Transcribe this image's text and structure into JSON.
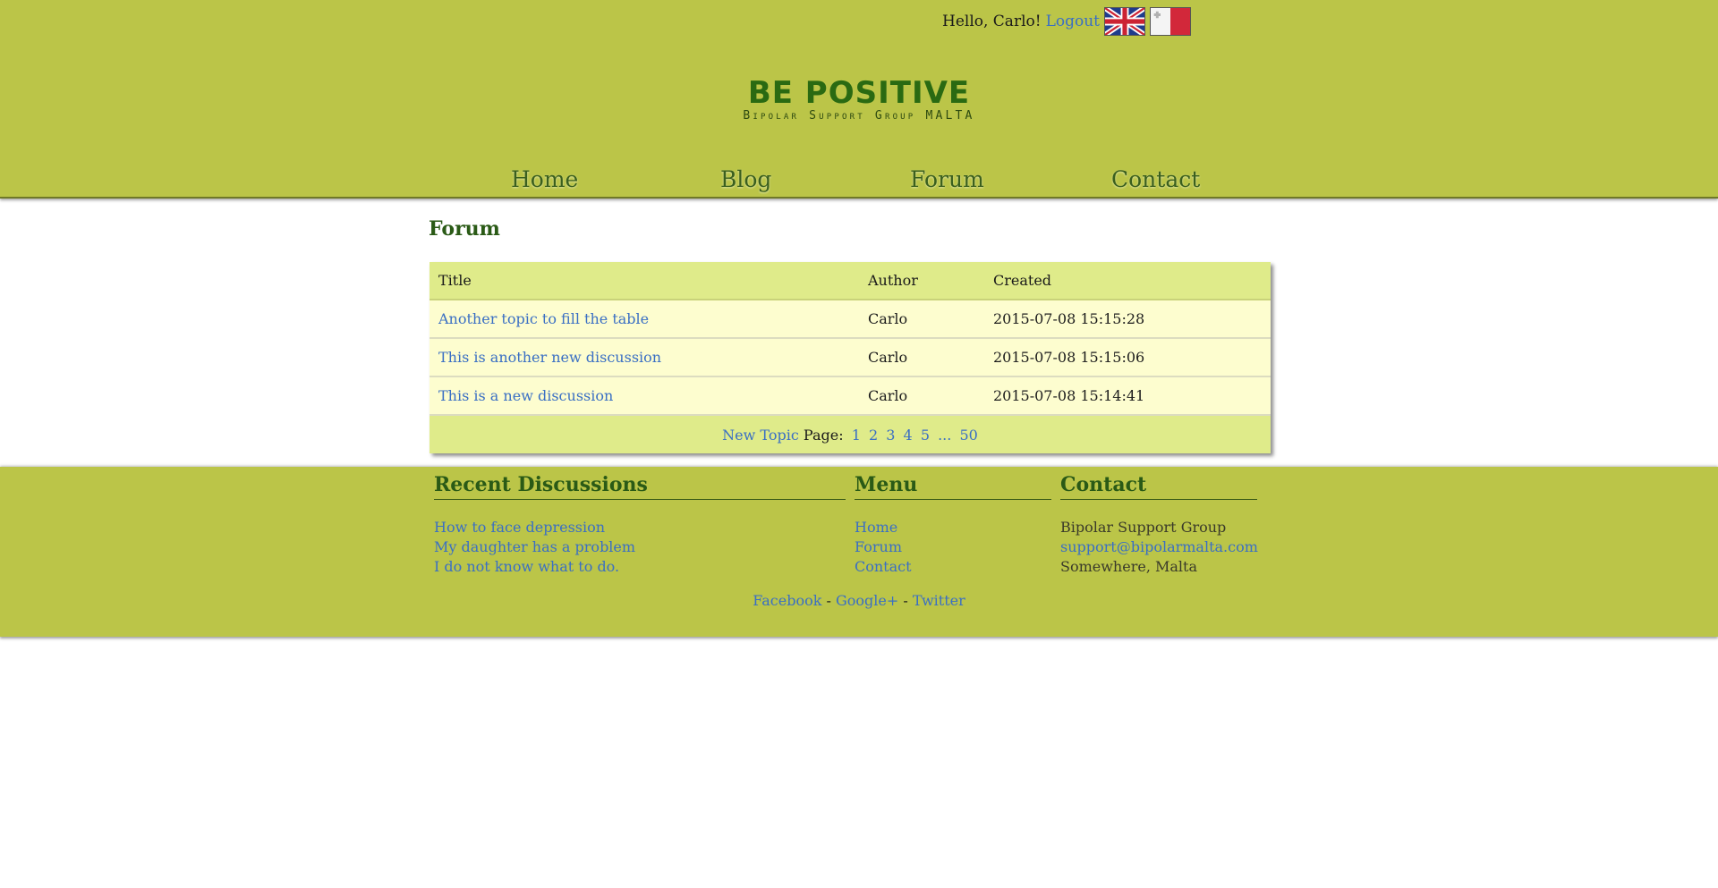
{
  "userbar": {
    "greeting": "Hello, Carlo!",
    "logout_label": "Logout",
    "flags": [
      "uk-flag-icon",
      "malta-flag-icon"
    ]
  },
  "logo": {
    "title": "BE POSITIVE",
    "subtitle": "Bipolar Support Group MALTA"
  },
  "nav": {
    "items": [
      {
        "label": "Home"
      },
      {
        "label": "Blog"
      },
      {
        "label": "Forum"
      },
      {
        "label": "Contact"
      }
    ]
  },
  "main": {
    "title": "Forum",
    "table": {
      "headers": [
        "Title",
        "Author",
        "Created"
      ],
      "rows": [
        {
          "title": "Another topic to fill the table",
          "author": "Carlo",
          "created": "2015-07-08 15:15:28"
        },
        {
          "title": "This is another new discussion",
          "author": "Carlo",
          "created": "2015-07-08 15:15:06"
        },
        {
          "title": "This is a new discussion",
          "author": "Carlo",
          "created": "2015-07-08 15:14:41"
        }
      ],
      "new_topic_label": "New Topic",
      "page_label": "Page:",
      "pages": [
        "1",
        "2",
        "3",
        "4",
        "5",
        "...",
        "50"
      ]
    }
  },
  "footer": {
    "recent": {
      "title": "Recent Discussions",
      "items": [
        "How to face depression",
        "My daughter has a problem",
        "I do not know what to do."
      ]
    },
    "menu": {
      "title": "Menu",
      "items": [
        "Home",
        "Forum",
        "Contact"
      ]
    },
    "contact": {
      "title": "Contact",
      "name": "Bipolar Support Group",
      "email": "support@bipolarmalta.com",
      "location": "Somewhere, Malta"
    },
    "social": {
      "facebook": "Facebook",
      "google": "Google+",
      "twitter": "Twitter",
      "separator": "-"
    }
  },
  "colors": {
    "header_bg": "#bbc548",
    "table_header_bg": "#dfeb8a",
    "table_row_bg": "#fdfdcf",
    "link": "#3a6fc4",
    "heading": "#2a5a16"
  }
}
